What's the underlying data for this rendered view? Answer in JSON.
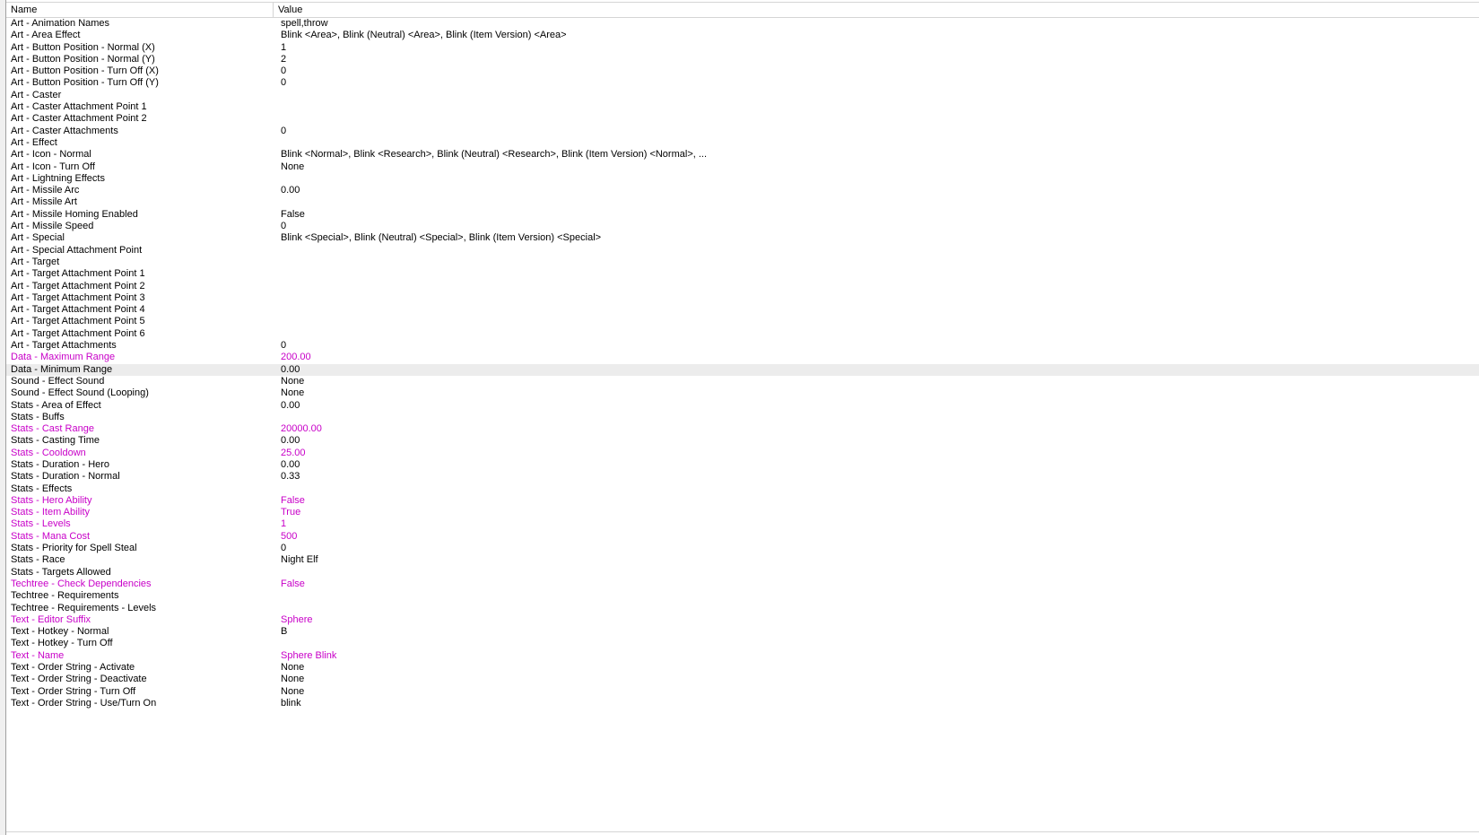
{
  "columns": {
    "name": "Name",
    "value": "Value"
  },
  "colors": {
    "modified_text": "#c800c8",
    "default_text": "#000000",
    "selected_row_bg": "#ececec"
  },
  "rows": [
    {
      "name": "Art - Animation Names",
      "value": "spell,throw",
      "modified": false
    },
    {
      "name": "Art - Area Effect",
      "value": "Blink <Area>, Blink (Neutral) <Area>, Blink (Item Version) <Area>",
      "modified": false
    },
    {
      "name": "Art - Button Position - Normal (X)",
      "value": "1",
      "modified": false
    },
    {
      "name": "Art - Button Position - Normal (Y)",
      "value": "2",
      "modified": false
    },
    {
      "name": "Art - Button Position - Turn Off (X)",
      "value": "0",
      "modified": false
    },
    {
      "name": "Art - Button Position - Turn Off (Y)",
      "value": "0",
      "modified": false
    },
    {
      "name": "Art - Caster",
      "value": "",
      "modified": false
    },
    {
      "name": "Art - Caster Attachment Point 1",
      "value": "",
      "modified": false
    },
    {
      "name": "Art - Caster Attachment Point 2",
      "value": "",
      "modified": false
    },
    {
      "name": "Art - Caster Attachments",
      "value": "0",
      "modified": false
    },
    {
      "name": "Art - Effect",
      "value": "",
      "modified": false
    },
    {
      "name": "Art - Icon - Normal",
      "value": "Blink <Normal>, Blink <Research>, Blink (Neutral) <Research>, Blink (Item Version) <Normal>, ...",
      "modified": false
    },
    {
      "name": "Art - Icon - Turn Off",
      "value": "None",
      "modified": false
    },
    {
      "name": "Art - Lightning Effects",
      "value": "",
      "modified": false
    },
    {
      "name": "Art - Missile Arc",
      "value": "0.00",
      "modified": false
    },
    {
      "name": "Art - Missile Art",
      "value": "",
      "modified": false
    },
    {
      "name": "Art - Missile Homing Enabled",
      "value": "False",
      "modified": false
    },
    {
      "name": "Art - Missile Speed",
      "value": "0",
      "modified": false
    },
    {
      "name": "Art - Special",
      "value": "Blink <Special>, Blink (Neutral) <Special>, Blink (Item Version) <Special>",
      "modified": false
    },
    {
      "name": "Art - Special Attachment Point",
      "value": "",
      "modified": false
    },
    {
      "name": "Art - Target",
      "value": "",
      "modified": false
    },
    {
      "name": "Art - Target Attachment Point 1",
      "value": "",
      "modified": false
    },
    {
      "name": "Art - Target Attachment Point 2",
      "value": "",
      "modified": false
    },
    {
      "name": "Art - Target Attachment Point 3",
      "value": "",
      "modified": false
    },
    {
      "name": "Art - Target Attachment Point 4",
      "value": "",
      "modified": false
    },
    {
      "name": "Art - Target Attachment Point 5",
      "value": "",
      "modified": false
    },
    {
      "name": "Art - Target Attachment Point 6",
      "value": "",
      "modified": false
    },
    {
      "name": "Art - Target Attachments",
      "value": "0",
      "modified": false
    },
    {
      "name": "Data - Maximum Range",
      "value": "200.00",
      "modified": true
    },
    {
      "name": "Data - Minimum Range",
      "value": "0.00",
      "modified": false,
      "selected": true
    },
    {
      "name": "Sound - Effect Sound",
      "value": "None",
      "modified": false
    },
    {
      "name": "Sound - Effect Sound (Looping)",
      "value": "None",
      "modified": false
    },
    {
      "name": "Stats - Area of Effect",
      "value": "0.00",
      "modified": false
    },
    {
      "name": "Stats - Buffs",
      "value": "",
      "modified": false
    },
    {
      "name": "Stats - Cast Range",
      "value": "20000.00",
      "modified": true
    },
    {
      "name": "Stats - Casting Time",
      "value": "0.00",
      "modified": false
    },
    {
      "name": "Stats - Cooldown",
      "value": "25.00",
      "modified": true
    },
    {
      "name": "Stats - Duration - Hero",
      "value": "0.00",
      "modified": false
    },
    {
      "name": "Stats - Duration - Normal",
      "value": "0.33",
      "modified": false
    },
    {
      "name": "Stats - Effects",
      "value": "",
      "modified": false
    },
    {
      "name": "Stats - Hero Ability",
      "value": "False",
      "modified": true
    },
    {
      "name": "Stats - Item Ability",
      "value": "True",
      "modified": true
    },
    {
      "name": "Stats - Levels",
      "value": "1",
      "modified": true
    },
    {
      "name": "Stats - Mana Cost",
      "value": "500",
      "modified": true
    },
    {
      "name": "Stats - Priority for Spell Steal",
      "value": "0",
      "modified": false
    },
    {
      "name": "Stats - Race",
      "value": "Night Elf",
      "modified": false
    },
    {
      "name": "Stats - Targets Allowed",
      "value": "",
      "modified": false
    },
    {
      "name": "Techtree - Check Dependencies",
      "value": "False",
      "modified": true
    },
    {
      "name": "Techtree - Requirements",
      "value": "",
      "modified": false
    },
    {
      "name": "Techtree - Requirements - Levels",
      "value": "",
      "modified": false
    },
    {
      "name": "Text - Editor Suffix",
      "value": "Sphere",
      "modified": true
    },
    {
      "name": "Text - Hotkey - Normal",
      "value": "B",
      "modified": false
    },
    {
      "name": "Text - Hotkey - Turn Off",
      "value": "",
      "modified": false
    },
    {
      "name": "Text - Name",
      "value": "Sphere Blink",
      "modified": true
    },
    {
      "name": "Text - Order String - Activate",
      "value": "None",
      "modified": false
    },
    {
      "name": "Text - Order String - Deactivate",
      "value": "None",
      "modified": false
    },
    {
      "name": "Text - Order String - Turn Off",
      "value": "None",
      "modified": false
    },
    {
      "name": "Text - Order String - Use/Turn On",
      "value": "blink",
      "modified": false
    }
  ]
}
